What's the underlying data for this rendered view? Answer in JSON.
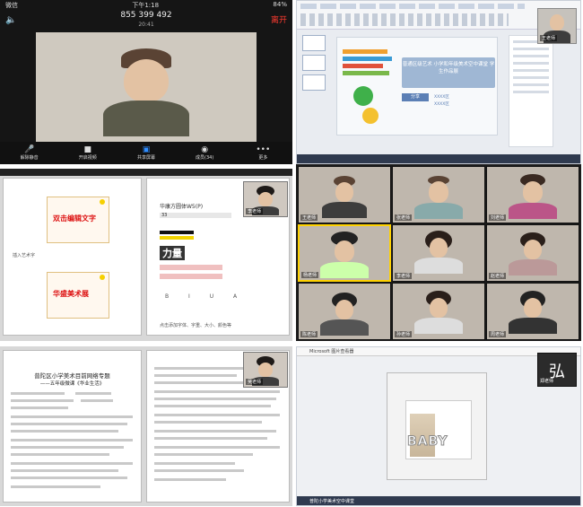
{
  "p1": {
    "carrier": "微信",
    "time": "下午1:18",
    "battery": "84%",
    "meeting_id": "855 399 492",
    "duration": "20:41",
    "leave": "离开",
    "toolbar": [
      "解除静音",
      "开启视频",
      "共享屏幕",
      "成员(34)",
      "更多"
    ],
    "toolbar_icons": [
      "mic-icon",
      "camera-icon",
      "share-icon",
      "participants-icon",
      "more-icon"
    ]
  },
  "p2": {
    "slide_title": "普通区级艺术 小学和年级美术空中课堂 学生作品展",
    "slide_subtitle": "分享",
    "slide_line1": "XXXX区",
    "slide_line2": "XXXX区",
    "cam_name": "王老师"
  },
  "p3": {
    "img1_label": "双击编辑文字",
    "img2_label": "华盛美术展",
    "cap1": "插入艺术字",
    "right_title": "华康方圆体W5(P)",
    "right_size": "33",
    "big_char": "力量",
    "fmt": "B I U A",
    "note": "点击添加字体、字重、大小、颜色等",
    "cam_name": "李老师"
  },
  "p4": {
    "tiles": [
      "王老师",
      "张老师",
      "刘老师",
      "杨老师",
      "李老师",
      "赵老师",
      "陈老师",
      "孙老师",
      "周老师"
    ]
  },
  "p5": {
    "title": "普陀区小学美术目前网络专题",
    "subtitle": "——五年级微课《华业生活》",
    "cam_name": "吴老师"
  },
  "p6": {
    "window_title": "Microsoft 图片查看器",
    "word": "BABY",
    "cam_name": "郑老师",
    "cam_logo": "弘",
    "taskbar_label": "普陀小学美术空中课堂"
  }
}
